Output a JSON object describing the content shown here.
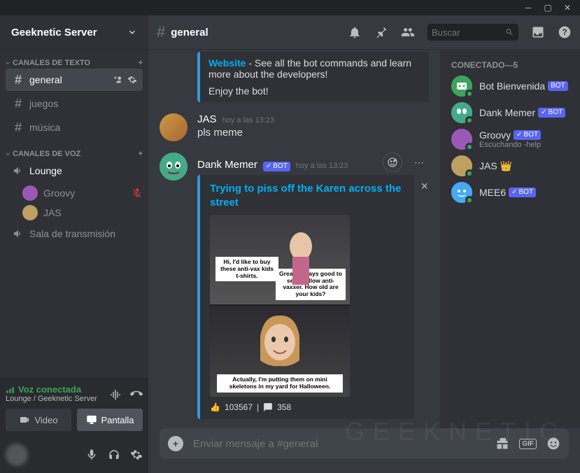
{
  "server": {
    "name": "Geeknetic Server"
  },
  "categories": {
    "text": {
      "header": "Canales de texto"
    },
    "voice": {
      "header": "Canales de voz"
    }
  },
  "channels": {
    "general": "general",
    "juegos": "juegos",
    "musica": "música",
    "lounge": "Lounge",
    "transmision": "Sala de transmisión"
  },
  "voice_users": {
    "groovy": "Groovy",
    "jas": "JAS"
  },
  "voice_panel": {
    "status": "Voz conectada",
    "path": "Lounge / Geeknetic Server",
    "video": "Video",
    "screen": "Pantalla"
  },
  "header": {
    "channel": "general",
    "search_placeholder": "Buscar"
  },
  "messages": {
    "bot_prev": {
      "link": "Website",
      "desc": " - See all the bot commands and learn more about the developers!",
      "enjoy": "Enjoy the bot!"
    },
    "jas": {
      "author": "JAS",
      "time": "hoy a las 13:23",
      "text": "pls meme"
    },
    "dank": {
      "author": "Dank Memer",
      "bot": "BOT",
      "time": "hoy a las 13:23",
      "embed_title": "Trying to piss off the Karen across the street",
      "cap1": "Hi, I'd like to buy these anti-vax kids t-shirts.",
      "cap2": "Great! Always good to see a fellow anti-vaxxer. How old are your kids?",
      "cap3": "Actually, I'm putting them on mini skeletons in my yard for Halloween.",
      "footer_up": "103567",
      "footer_comments": "358"
    }
  },
  "input": {
    "placeholder": "Enviar mensaje a #general"
  },
  "members": {
    "header": "Conectado—5",
    "bot_bienvenida": "Bot Bienvenida",
    "dank": "Dank Memer",
    "groovy": "Groovy",
    "groovy_status": "Escuchando -help",
    "jas": "JAS",
    "mee6": "MEE6",
    "bot_tag": "BOT"
  },
  "watermark": "GEEKNETIC"
}
